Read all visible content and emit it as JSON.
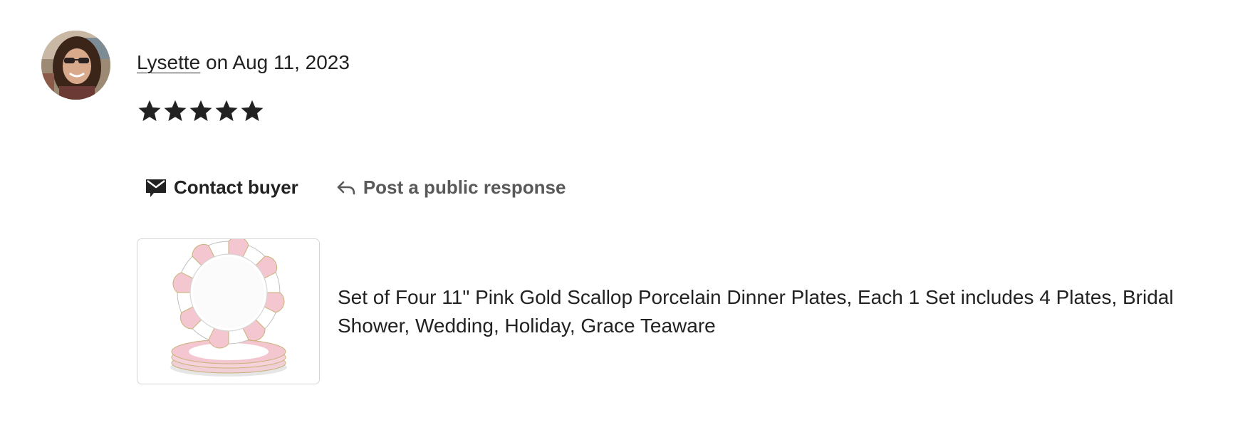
{
  "review": {
    "reviewer_name": "Lysette",
    "date_text": " on Aug 11, 2023",
    "rating": 5,
    "max_rating": 5
  },
  "actions": {
    "contact_label": "Contact buyer",
    "respond_label": "Post a public response"
  },
  "listing": {
    "title": "Set of Four 11\" Pink Gold Scallop Porcelain Dinner Plates, Each 1 Set includes 4 Plates, Bridal Shower, Wedding, Holiday, Grace Teaware"
  },
  "colors": {
    "text": "#222222",
    "secondary_text": "#595959",
    "star": "#222222",
    "plate_pink": "#f4c6cf"
  },
  "icons": {
    "contact": "envelope-icon",
    "respond": "reply-arrow-icon",
    "star": "star-icon"
  }
}
